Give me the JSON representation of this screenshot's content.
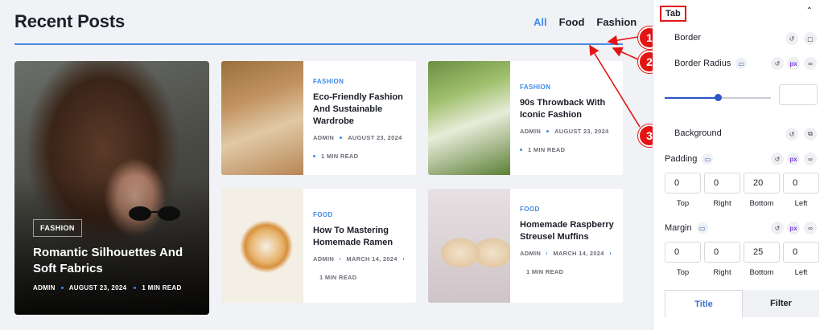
{
  "page": {
    "title": "Recent Posts",
    "filters": [
      "All",
      "Food",
      "Fashion"
    ],
    "active_filter": "All"
  },
  "featured": {
    "category": "FASHION",
    "title": "Romantic Silhouettes And Soft Fabrics",
    "author": "ADMIN",
    "date": "AUGUST 23, 2024",
    "read": "1 MIN READ"
  },
  "posts": [
    {
      "category": "FASHION",
      "title": "Eco-Friendly Fashion And Sustainable Wardrobe",
      "author": "ADMIN",
      "date": "AUGUST 23, 2024",
      "read": "1 MIN READ"
    },
    {
      "category": "FASHION",
      "title": "90s Throwback With Iconic Fashion",
      "author": "ADMIN",
      "date": "AUGUST 23, 2024",
      "read": "1 MIN READ"
    },
    {
      "category": "FOOD",
      "title": "How To Mastering Homemade Ramen",
      "author": "ADMIN",
      "date": "MARCH 14, 2024",
      "read": "1 MIN READ"
    },
    {
      "category": "FOOD",
      "title": "Homemade Raspberry Streusel Muffins",
      "author": "ADMIN",
      "date": "MARCH 14, 2024",
      "read": "1 MIN READ"
    }
  ],
  "annotations": [
    "1",
    "2",
    "3"
  ],
  "panel": {
    "tab_label": "Tab",
    "border_label": "Border",
    "border_radius_label": "Border Radius",
    "unit": "px",
    "slider_value_fraction": 0.5,
    "background_label": "Background",
    "padding_label": "Padding",
    "padding_values": [
      "0",
      "0",
      "20",
      "0"
    ],
    "margin_label": "Margin",
    "margin_values": [
      "0",
      "0",
      "25",
      "0"
    ],
    "side_labels": [
      "Top",
      "Right",
      "Bottom",
      "Left"
    ],
    "state_tabs": [
      "Title",
      "Filter"
    ]
  },
  "icons": {
    "reset": "reset-icon",
    "unlink": "link-icon",
    "monitor": "desktop-icon",
    "chevron": "chevron-up-icon"
  },
  "colors": {
    "accent": "#3f8be6",
    "annotation": "#e41414",
    "panel_accent": "#2b55c9"
  }
}
